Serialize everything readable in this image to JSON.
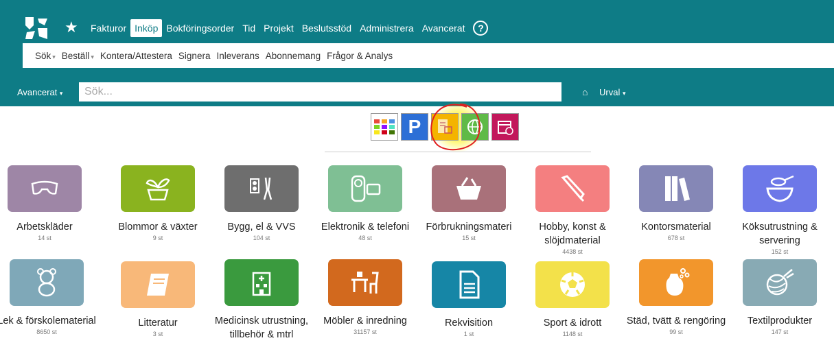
{
  "topnav": {
    "items": [
      "Fakturor",
      "Inköp",
      "Bokföringsorder",
      "Tid",
      "Projekt",
      "Beslutsstöd",
      "Administrera",
      "Avancerat"
    ],
    "active": "Inköp",
    "help": "?"
  },
  "subnav": {
    "items": [
      {
        "label": "Sök",
        "caret": true
      },
      {
        "label": "Beställ",
        "caret": true
      },
      {
        "label": "Kontera/Attestera",
        "caret": false
      },
      {
        "label": "Signera",
        "caret": false
      },
      {
        "label": "Inleverans",
        "caret": false
      },
      {
        "label": "Abonnemang",
        "caret": false
      },
      {
        "label": "Frågor & Analys",
        "caret": false
      }
    ]
  },
  "search": {
    "advanced_label": "Avancerat",
    "placeholder": "Sök...",
    "urval_label": "Urval"
  },
  "toolbar_icons": [
    "grid-view-icon",
    "parking-icon",
    "catalog-icon",
    "web-shop-icon",
    "calendar-icon"
  ],
  "categories": [
    {
      "name": "Arbetskläder",
      "count": "14 st",
      "color": "#9e86a6",
      "icon": "goggles-icon"
    },
    {
      "name": "Blommor & växter",
      "count": "9 st",
      "color": "#8ab31f",
      "icon": "plant-icon"
    },
    {
      "name": "Bygg, el & VVS",
      "count": "104 st",
      "color": "#6e6e6e",
      "icon": "tools-icon"
    },
    {
      "name": "Elektronik & telefoni",
      "count": "48 st",
      "color": "#7fbf94",
      "icon": "phone-icon"
    },
    {
      "name": "Förbrukningsmateri",
      "count": "15 st",
      "color": "#a9717a",
      "icon": "basket-icon"
    },
    {
      "name": "Hobby, konst & slöjdmaterial",
      "count": "4438 st",
      "color": "#f47f80",
      "icon": "paint-tube-icon"
    },
    {
      "name": "Kontorsmaterial",
      "count": "678 st",
      "color": "#8587b6",
      "icon": "binders-icon"
    },
    {
      "name": "Köksutrustning & servering",
      "count": "152 st",
      "color": "#6d78e8",
      "icon": "bowl-icon"
    },
    {
      "name": "Lek & förskolematerial",
      "count": "8650 st",
      "color": "#7fa8b8",
      "icon": "teddy-bear-icon"
    },
    {
      "name": "Litteratur",
      "count": "3 st",
      "color": "#f8b879",
      "icon": "book-icon"
    },
    {
      "name": "Medicinsk utrustning, tillbehör & mtrl",
      "count": "",
      "color": "#3a9a3e",
      "icon": "hospital-icon"
    },
    {
      "name": "Möbler & inredning",
      "count": "31157 st",
      "color": "#d2691e",
      "icon": "desk-icon"
    },
    {
      "name": "Rekvisition",
      "count": "1 st",
      "color": "#1686a6",
      "icon": "document-icon"
    },
    {
      "name": "Sport & idrott",
      "count": "1148 st",
      "color": "#f3e14a",
      "icon": "football-icon"
    },
    {
      "name": "Städ, tvätt & rengöring",
      "count": "99 st",
      "color": "#f2962c",
      "icon": "detergent-icon"
    },
    {
      "name": "Textilprodukter",
      "count": "147 st",
      "color": "#88aab4",
      "icon": "yarn-icon"
    }
  ]
}
